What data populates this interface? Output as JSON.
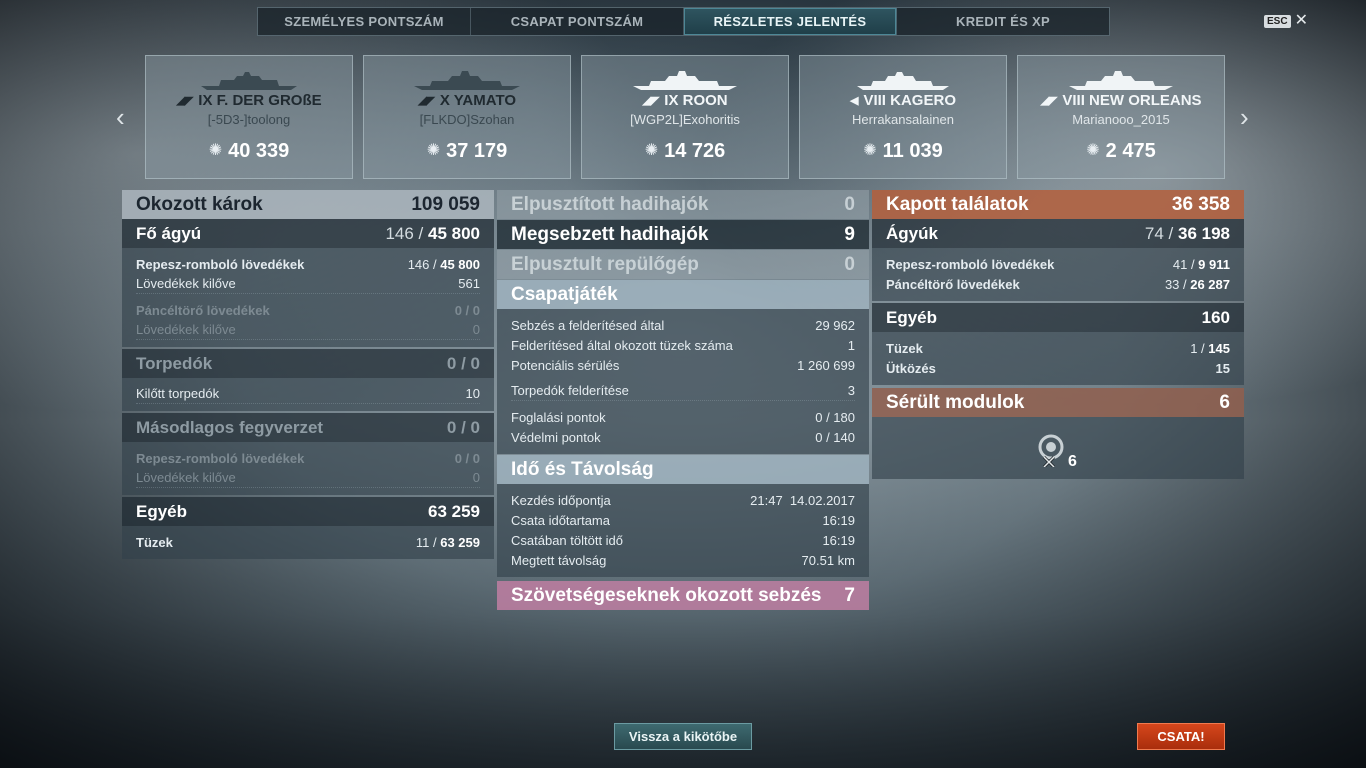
{
  "tabs": [
    {
      "label": "SZEMÉLYES PONTSZÁM",
      "active": false
    },
    {
      "label": "CSAPAT PONTSZÁM",
      "active": false
    },
    {
      "label": "RÉSZLETES JELENTÉS",
      "active": true
    },
    {
      "label": "KREDIT ÉS XP",
      "active": false
    }
  ],
  "esc": {
    "key": "ESC",
    "close": "✕"
  },
  "nav": {
    "prev": "‹",
    "next": "›"
  },
  "ships": [
    {
      "name": "IX F. DER GROßE",
      "player": "[-5D3-]toolong",
      "score": "40 339",
      "team": "enemy"
    },
    {
      "name": "X YAMATO",
      "player": "[FLKDO]Szohan",
      "score": "37 179",
      "team": "enemy"
    },
    {
      "name": "IX ROON",
      "player": "[WGP2L]Exohoritis",
      "score": "14 726",
      "team": "ally"
    },
    {
      "name": "VIII KAGERO",
      "player": "Herrakansalainen",
      "score": "11 039",
      "team": "ally"
    },
    {
      "name": "VIII NEW ORLEANS",
      "player": "Marianooo_2015",
      "score": "2 475",
      "team": "ally"
    }
  ],
  "left": {
    "dealt": {
      "label": "Okozott károk",
      "value": "109 059"
    },
    "main": {
      "label": "Fő ágyú",
      "value_a": "146 / ",
      "value_b": "45 800"
    },
    "he": {
      "label": "Repesz-romboló lövedékek",
      "value_a": "146 / ",
      "value_b": "45 800"
    },
    "he_fired": {
      "label": "Lövedékek kilőve",
      "value": "561"
    },
    "ap": {
      "label": "Páncéltörő lövedékek",
      "value": "0 / 0"
    },
    "ap_fired": {
      "label": "Lövedékek kilőve",
      "value": "0"
    },
    "torp": {
      "label": "Torpedók",
      "value": "0 / 0"
    },
    "torp_fired": {
      "label": "Kilőtt torpedók",
      "value": "10"
    },
    "sec": {
      "label": "Másodlagos fegyverzet",
      "value": "0 / 0"
    },
    "sec_he": {
      "label": "Repesz-romboló lövedékek",
      "value": "0 / 0"
    },
    "sec_fired": {
      "label": "Lövedékek kilőve",
      "value": "0"
    },
    "other": {
      "label": "Egyéb",
      "value": "63 259"
    },
    "fires": {
      "label": "Tüzek",
      "value_a": "11 / ",
      "value_b": "63 259"
    }
  },
  "middle": {
    "destroyed_ships": {
      "label": "Elpusztított hadihajók",
      "value": "0"
    },
    "damaged_ships": {
      "label": "Megsebzett hadihajók",
      "value": "9"
    },
    "planes": {
      "label": "Elpusztult repülőgép",
      "value": "0"
    },
    "team": {
      "label": "Csapatjáték"
    },
    "spot_dmg": {
      "label": "Sebzés a felderítésed által",
      "value": "29 962"
    },
    "spot_fires": {
      "label": "Felderítésed által okozott tüzek száma",
      "value": "1"
    },
    "potential": {
      "label": "Potenciális sérülés",
      "value": "1 260 699"
    },
    "torp_spot": {
      "label": "Torpedók felderítése",
      "value": "3"
    },
    "capture": {
      "label": "Foglalási pontok",
      "value": "0 / 180"
    },
    "defense": {
      "label": "Védelmi pontok",
      "value": "0 / 140"
    },
    "time": {
      "label": "Idő és Távolság"
    },
    "start": {
      "label": "Kezdés időpontja",
      "value": "21:47  14.02.2017"
    },
    "duration": {
      "label": "Csata időtartama",
      "value": "16:19"
    },
    "in_battle": {
      "label": "Csatában töltött idő",
      "value": "16:19"
    },
    "distance": {
      "label": "Megtett távolság",
      "value": "70.51 km"
    },
    "ally_dmg": {
      "label": "Szövetségeseknek okozott sebzés",
      "value": "7"
    }
  },
  "right": {
    "received": {
      "label": "Kapott találatok",
      "value": "36 358"
    },
    "guns": {
      "label": "Ágyúk",
      "value_a": "74 / ",
      "value_b": "36 198"
    },
    "he": {
      "label": "Repesz-romboló lövedékek",
      "value_a": "41 / ",
      "value_b": "9 911"
    },
    "ap": {
      "label": "Páncéltörő lövedékek",
      "value_a": "33 / ",
      "value_b": "26 287"
    },
    "other": {
      "label": "Egyéb",
      "value": "160"
    },
    "fires": {
      "label": "Tüzek",
      "value_a": "1 / ",
      "value_b": "145"
    },
    "ram": {
      "label": "Ütközés",
      "value": "15"
    },
    "modules": {
      "label": "Sérült modulok",
      "value": "6"
    },
    "module_count": "6"
  },
  "buttons": {
    "port": "Vissza a kikötőbe",
    "battle": "CSATA!"
  },
  "colors": {
    "accent": "#2f5560",
    "battle": "#d6471c",
    "received": "#b45f3c",
    "ally_damage": "#b97da0"
  }
}
